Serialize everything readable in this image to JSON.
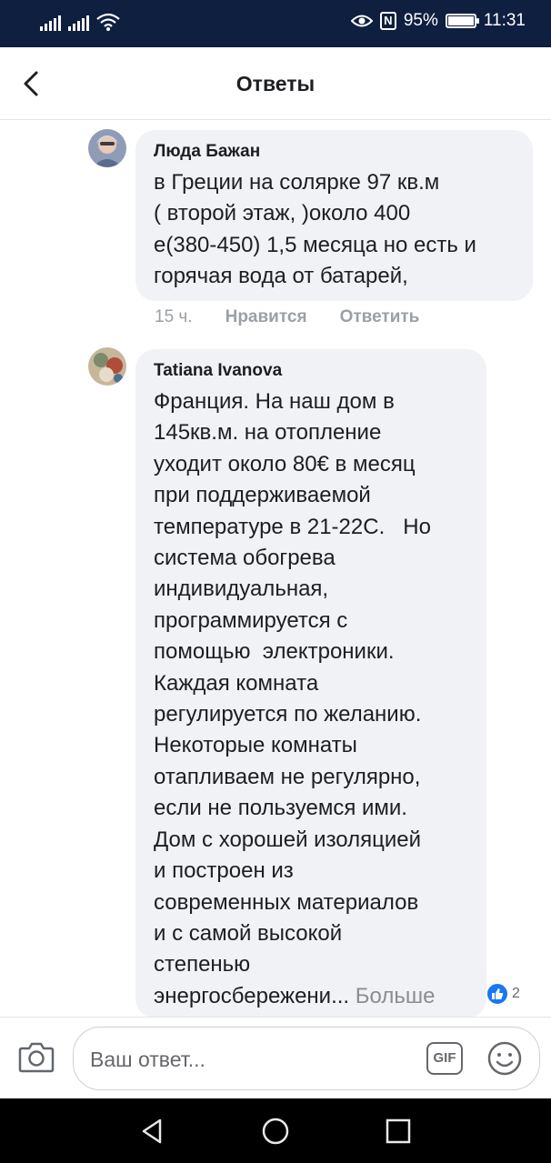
{
  "status_bar": {
    "battery_percent": "95%",
    "battery_level": 0.95,
    "time": "11:31",
    "nfc_label": "N",
    "icons": [
      "signal-icon",
      "signal-icon",
      "wifi-icon",
      "eye-icon",
      "nfc-icon",
      "battery-icon"
    ]
  },
  "header": {
    "title": "Ответы",
    "back_icon": "chevron-left-icon"
  },
  "comments": [
    {
      "author": "Люда Бажан",
      "text": "в Греции на солярке 97 кв.м\n( второй этаж, )около 400\nе(380-450) 1,5 месяца но есть и\nгорячая вода от батарей,",
      "time": "15 ч.",
      "like_label": "Нравится",
      "reply_label": "Ответить"
    },
    {
      "author": "Tatiana Ivanova",
      "text": "Франция. На наш дом в\n145кв.м. на отопление\nуходит около 80€ в месяц\nпри поддерживаемой\nтемпературе в 21-22С.   Но\nсистема обогрева\nиндивидуальная,\nпрограммируется с\nпомощью  электроники.\nКаждая комната\nрегулируется по желанию.\nНекоторые комнаты\nотапливаем не регулярно,\nесли не пользуемся ими.\nДом с хорошей изоляцией\nи построен из\nсовременных материалов\nи с самой высокой\nстепенью\nэнергосбережени...",
      "more_label": "Больше",
      "reaction_count": "2",
      "reaction_icon": "like-icon"
    }
  ],
  "compose": {
    "placeholder": "Ваш ответ...",
    "gif_label": "GIF",
    "camera_icon": "camera-icon",
    "emoji_icon": "smiley-icon"
  },
  "nav": {
    "icons": [
      "back-triangle-icon",
      "home-circle-icon",
      "recents-square-icon"
    ]
  },
  "colors": {
    "status_bar": "#0e1f40",
    "bubble": "#f0f2f5",
    "accent": "#1877f2",
    "muted": "#9ba0a6"
  }
}
